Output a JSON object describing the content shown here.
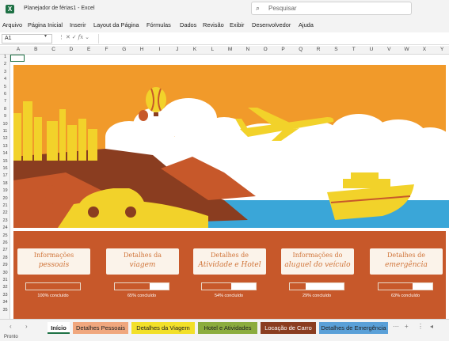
{
  "window": {
    "title": "Planejador de férias1  -  Excel",
    "search_placeholder": "Pesquisar",
    "app_icon_letter": "X"
  },
  "menu": [
    "Arquivo",
    "Página Inicial",
    "Inserir",
    "Layout da Página",
    "Fórmulas",
    "Dados",
    "Revisão",
    "Exibir",
    "Desenvolvedor",
    "Ajuda"
  ],
  "formula_bar": {
    "name_box": "A1",
    "fx_label": "fx"
  },
  "columns": [
    "A",
    "B",
    "C",
    "D",
    "E",
    "F",
    "G",
    "H",
    "I",
    "J",
    "K",
    "L",
    "M",
    "N",
    "O",
    "P",
    "Q",
    "R",
    "S",
    "T",
    "U",
    "V",
    "W",
    "X",
    "Y"
  ],
  "rows": [
    "1",
    "2",
    "3",
    "4",
    "5",
    "6",
    "7",
    "8",
    "9",
    "10",
    "11",
    "12",
    "13",
    "14",
    "15",
    "16",
    "17",
    "18",
    "19",
    "20",
    "21",
    "22",
    "23",
    "24",
    "25",
    "26",
    "27",
    "28",
    "29",
    "30",
    "31",
    "32",
    "33",
    "34",
    "35"
  ],
  "cards": [
    {
      "title": "Informações",
      "subtitle": "pessoais",
      "progress": 1.0,
      "progress_label": "100% concluído"
    },
    {
      "title": "Detalhes da",
      "subtitle": "viagem",
      "progress": 0.65,
      "progress_label": "65% concluído"
    },
    {
      "title": "Detalhes de",
      "subtitle": "Atividade e Hotel",
      "progress": 0.54,
      "progress_label": "54% concluído"
    },
    {
      "title": "Informações do",
      "subtitle": "aluguel do veículo",
      "progress": 0.29,
      "progress_label": "29% concluído"
    },
    {
      "title": "Detalhes de",
      "subtitle": "emergência",
      "progress": 0.63,
      "progress_label": "63% concluído"
    }
  ],
  "sheet_tabs": [
    {
      "label": "Início",
      "color": "#ffffff"
    },
    {
      "label": "Detalhes Pessoais",
      "color": "#f0a77e"
    },
    {
      "label": "Detalhes da Viagem",
      "color": "#f2e029"
    },
    {
      "label": "Hotel e Atividades",
      "color": "#8bac3e"
    },
    {
      "label": "Locação de Carro",
      "color": "#8a3d20"
    },
    {
      "label": "Detalhes de Emergência",
      "color": "#5aa0d8"
    }
  ],
  "status": "Pronto",
  "colors": {
    "accent": "#1e7145",
    "sky": "#f19a2a",
    "sea": "#3aa6d8",
    "panel": "#c7582a",
    "card_text": "#d0753a"
  }
}
